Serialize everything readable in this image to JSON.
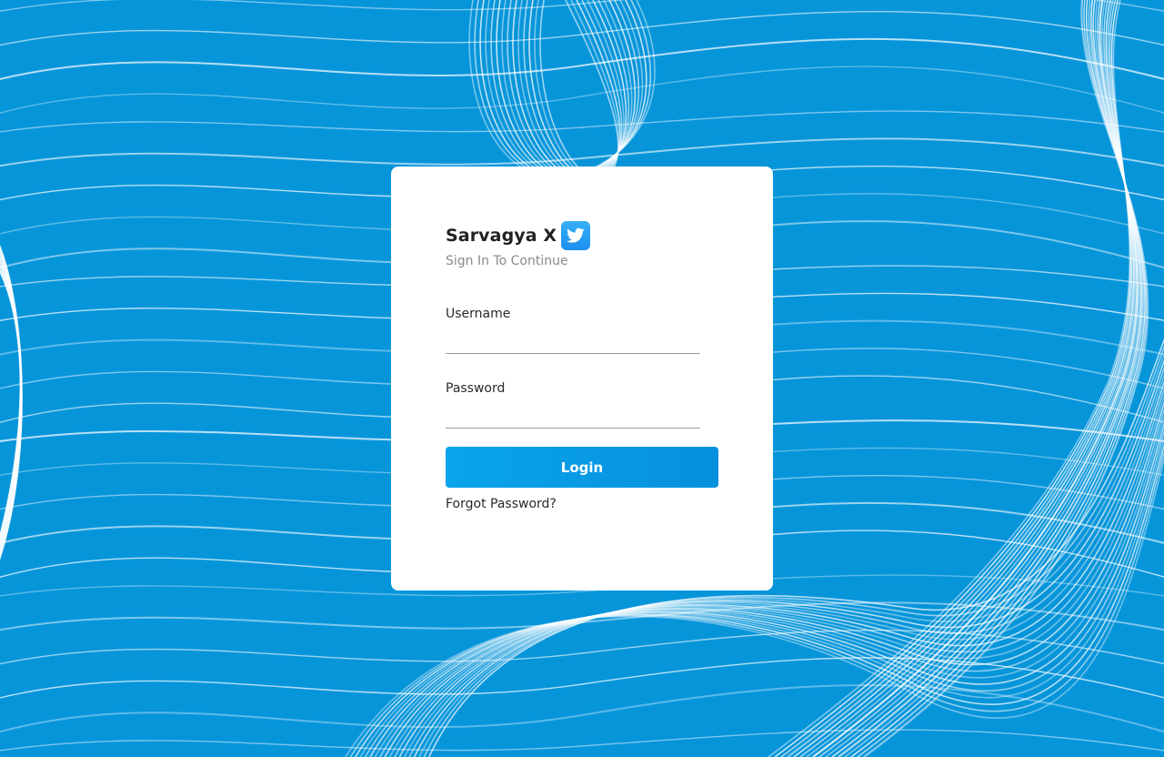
{
  "login": {
    "brand": "Sarvagya X",
    "subtitle": "Sign In To Continue",
    "username_label": "Username",
    "username_value": "",
    "password_label": "Password",
    "password_value": "",
    "login_button": "Login",
    "forgot_password": "Forgot Password?",
    "brand_icon": "twitter-bird-icon"
  },
  "colors": {
    "background": "#0795da",
    "button": "#08a4ec",
    "card": "#ffffff"
  }
}
